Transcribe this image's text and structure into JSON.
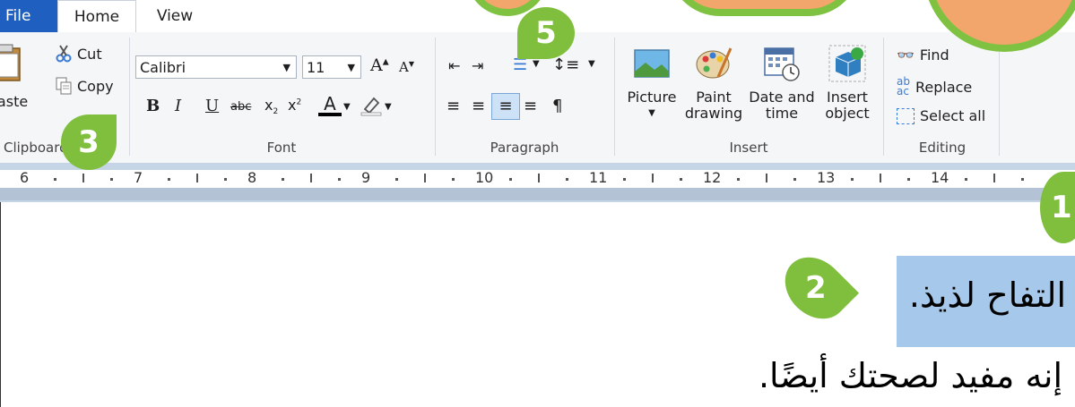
{
  "tabs": {
    "file": "File",
    "home": "Home",
    "view": "View"
  },
  "clipboard": {
    "paste": "Paste",
    "cut": "Cut",
    "copy": "Copy",
    "label": "Clipboard"
  },
  "font": {
    "name": "Calibri",
    "size": "11",
    "label": "Font"
  },
  "paragraph": {
    "label": "Paragraph"
  },
  "insert": {
    "picture": "Picture",
    "paint1": "Paint",
    "paint2": "drawing",
    "date1": "Date and",
    "date2": "time",
    "object1": "Insert",
    "object2": "object",
    "label": "Insert"
  },
  "editing": {
    "find": "Find",
    "replace": "Replace",
    "select_all": "Select all",
    "label": "Editing"
  },
  "ruler": [
    "6",
    "7",
    "8",
    "9",
    "10",
    "11",
    "12",
    "13",
    "14"
  ],
  "document": {
    "line1": "التفاح لذيذ.",
    "line2": "إنه مفيد لصحتك أيضًا."
  },
  "callouts": {
    "c1": "1",
    "c2": "2",
    "c3": "3",
    "c5": "5"
  },
  "colors": {
    "accent": "#1f5fbf",
    "callout": "#7fbf3d",
    "selection": "#a6c8ea"
  }
}
